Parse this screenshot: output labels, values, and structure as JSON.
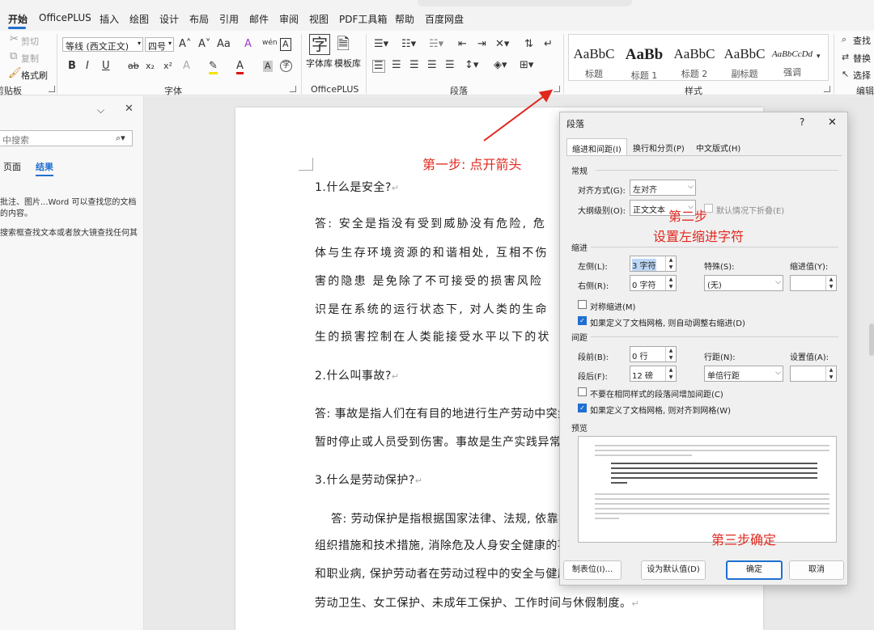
{
  "menu": {
    "items": [
      "开始",
      "OfficePLUS",
      "插入",
      "绘图",
      "设计",
      "布局",
      "引用",
      "邮件",
      "审阅",
      "视图",
      "PDF工具箱",
      "帮助",
      "百度网盘"
    ],
    "active_index": 0
  },
  "ribbon": {
    "clipboard": {
      "cut": "剪切",
      "copy": "复制",
      "format_painter": "格式刷",
      "group_label": "剪贴板"
    },
    "font": {
      "font_name": "等线 (西文正文)",
      "font_size": "四号",
      "grow": "A˄",
      "shrink": "A˅",
      "case": "Aa",
      "clear": "A",
      "phonetic": "wén",
      "border_char": "A",
      "bold": "B",
      "italic": "I",
      "underline": "U",
      "strike": "ab",
      "subscript": "x₂",
      "superscript": "x²",
      "text_effect": "A",
      "highlight": "✎",
      "font_color": "A",
      "shading_char": "A",
      "enclose": "字",
      "group_label": "字体"
    },
    "officeplus": {
      "zi_ku": "字体库",
      "mo_ban": "模板库",
      "group_label": "OfficePLUS",
      "zi_glyph": "字"
    },
    "paragraph": {
      "group_label": "段落"
    },
    "styles": {
      "items": [
        {
          "sample": "AaBbC",
          "name": "标题"
        },
        {
          "sample": "AaBb",
          "name": "标题 1"
        },
        {
          "sample": "AaBbC",
          "name": "标题 2"
        },
        {
          "sample": "AaBbC",
          "name": "副标题"
        },
        {
          "sample": "AaBbCcDd",
          "name": "强调"
        }
      ],
      "group_label": "样式"
    },
    "editing": {
      "find": "查找",
      "replace": "替换",
      "select": "选择",
      "group_label": "编辑"
    }
  },
  "leftpane": {
    "search_placeholder": "中搜索",
    "tabs": [
      "页面",
      "结果"
    ],
    "active_tab": "结果",
    "help_lines": [
      "批注、图片...Word 可以查找您的文档",
      "的内容。"
    ],
    "help_line2": "搜索框查找文本或者放大镜查找任何其"
  },
  "document": {
    "lines": [
      "1.什么是安全?",
      "答: 安全是指没有受到威胁没有危险, 危",
      "体与生存环境资源的和谐相处, 互相不伤",
      "害的隐患 是免除了不可接受的损害风险",
      "识是在系统的运行状态下, 对人类的生命",
      "生的损害控制在人类能接受水平以下的状",
      "2.什么叫事故?",
      "答: 事故是指人们在有目的地进行生产劳动中突然",
      "暂时停止或人员受到伤害。事故是生产实践异常的",
      "3.什么是劳动保护?",
      "答: 劳动保护是指根据国家法律、法规, 依靠技",
      "组织措施和技术措施, 消除危及人身安全健康的不",
      "和职业病, 保护劳动者在劳动过程中的安全与健康",
      "劳动卫生、女工保护、未成年工保护、工作时间与休假制度。"
    ],
    "para_mark": "↵"
  },
  "annotations": {
    "step1": "第一步: 点开箭头",
    "step2a": "第二步",
    "step2b": "设置左缩进字符",
    "step3": "第三步确定",
    "color": "#e0281e"
  },
  "dialog": {
    "title": "段落",
    "help": "?",
    "close": "✕",
    "tabs": [
      "缩进和间距(I)",
      "换行和分页(P)",
      "中文版式(H)"
    ],
    "general_label": "常规",
    "alignment_label": "对齐方式(G):",
    "alignment_value": "左对齐",
    "outline_label": "大纲级别(O):",
    "outline_value": "正文文本",
    "collapse_label": "默认情况下折叠(E)",
    "indent_label": "缩进",
    "left_label": "左侧(L):",
    "left_value": "3 字符",
    "right_label": "右侧(R):",
    "right_value": "0 字符",
    "special_label": "特殊(S):",
    "special_value": "(无)",
    "indent_value_label": "缩进值(Y):",
    "mirror_label": "对称缩进(M)",
    "auto_adjust_label": "如果定义了文档网格, 则自动调整右缩进(D)",
    "spacing_label": "间距",
    "before_label": "段前(B):",
    "before_value": "0 行",
    "after_label": "段后(F):",
    "after_value": "12 磅",
    "line_spacing_label": "行距(N):",
    "line_spacing_value": "单倍行距",
    "set_value_label": "设置值(A):",
    "no_space_label": "不要在相同样式的段落间增加间距(C)",
    "snap_grid_label": "如果定义了文档网格, 则对齐到网格(W)",
    "preview_label": "预览",
    "buttons": {
      "tabs": "制表位(I)...",
      "default": "设为默认值(D)",
      "ok": "确定",
      "cancel": "取消"
    }
  }
}
